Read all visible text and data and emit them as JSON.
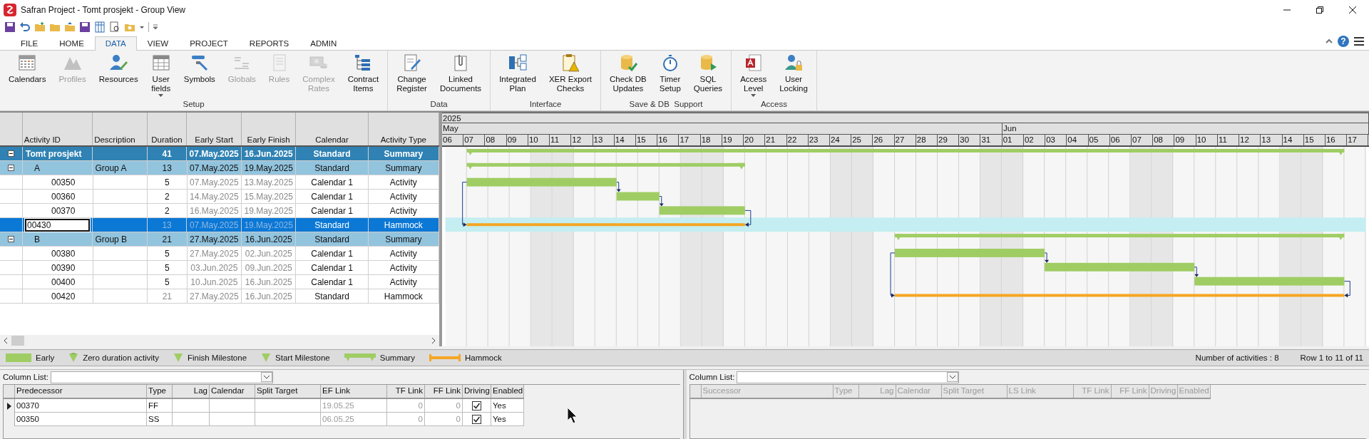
{
  "window": {
    "title": "Safran Project - Tomt prosjekt - Group View"
  },
  "tabs": [
    {
      "label": "FILE",
      "selected": false
    },
    {
      "label": "HOME",
      "selected": false
    },
    {
      "label": "DATA",
      "selected": true
    },
    {
      "label": "VIEW",
      "selected": false
    },
    {
      "label": "PROJECT",
      "selected": false
    },
    {
      "label": "REPORTS",
      "selected": false
    },
    {
      "label": "ADMIN",
      "selected": false
    }
  ],
  "help_button": "?",
  "ribbon": [
    {
      "label": "Setup",
      "buttons": [
        {
          "label": "Calendars",
          "disabled": false
        },
        {
          "label": "Profiles",
          "disabled": true
        },
        {
          "label": "Resources",
          "disabled": false
        },
        {
          "label": "User\nfields",
          "disabled": false,
          "dropdown": true
        },
        {
          "label": "Symbols",
          "disabled": false
        },
        {
          "label": "Globals",
          "disabled": true
        },
        {
          "label": "Rules",
          "disabled": true
        },
        {
          "label": "Complex\nRates",
          "disabled": true
        },
        {
          "label": "Contract\nItems",
          "disabled": false
        }
      ]
    },
    {
      "label": "Data",
      "buttons": [
        {
          "label": "Change\nRegister",
          "disabled": false
        },
        {
          "label": "Linked\nDocuments",
          "disabled": false
        }
      ]
    },
    {
      "label": "Interface",
      "buttons": [
        {
          "label": "Integrated\nPlan",
          "disabled": false
        },
        {
          "label": "XER Export\nChecks",
          "disabled": false
        }
      ]
    },
    {
      "label": "Save & DB  Support",
      "buttons": [
        {
          "label": "Check DB\nUpdates",
          "disabled": false
        },
        {
          "label": "Timer\nSetup",
          "disabled": false
        },
        {
          "label": "SQL\nQueries",
          "disabled": false
        }
      ]
    },
    {
      "label": "Access",
      "buttons": [
        {
          "label": "Access\nLevel",
          "disabled": false,
          "dropdown": true
        },
        {
          "label": "User\nLocking",
          "disabled": false
        }
      ]
    }
  ],
  "table": {
    "columns": [
      "Activity ID",
      "Description",
      "Duration",
      "Early Start",
      "Early Finish",
      "Calendar",
      "Activity Type"
    ],
    "rows": [
      {
        "kind": "project",
        "id": "Tomt prosjekt",
        "duration": "41",
        "early_start": "07.May.2025",
        "early_finish": "16.Jun.2025",
        "calendar": "Standard",
        "activity_type": "Summary",
        "expanded": true,
        "selected": false,
        "editing": false,
        "children": [
          {
            "kind": "group",
            "id": "A",
            "description": "Group A",
            "duration": "13",
            "early_start": "07.May.2025",
            "early_finish": "19.May.2025",
            "calendar": "Standard",
            "activity_type": "Summary",
            "expanded": true,
            "selected": false,
            "editing": false,
            "children": [
              {
                "kind": "activity",
                "id": "00350",
                "duration": "5",
                "early_start": "07.May.2025",
                "early_finish": "13.May.2025",
                "calendar": "Calendar 1",
                "activity_type": "Activity",
                "selected": false,
                "editing": false
              },
              {
                "kind": "activity",
                "id": "00360",
                "duration": "2",
                "early_start": "14.May.2025",
                "early_finish": "15.May.2025",
                "calendar": "Calendar 1",
                "activity_type": "Activity",
                "selected": false,
                "editing": false,
                "links": [
                  {
                    "kind": "finish_to_start"
                  }
                ]
              },
              {
                "kind": "activity",
                "id": "00370",
                "duration": "2",
                "early_start": "16.May.2025",
                "early_finish": "19.May.2025",
                "calendar": "Calendar 1",
                "activity_type": "Activity",
                "selected": false,
                "editing": false,
                "links": [
                  {
                    "kind": "finish_to_start"
                  }
                ]
              },
              {
                "kind": "hammock",
                "id": "00430",
                "duration": "13",
                "early_start": "07.May.2025",
                "early_finish": "19.May.2025",
                "calendar": "Standard",
                "activity_type": "Hammock",
                "selected": true,
                "editing": true,
                "links": [
                  {
                    "kind": "start_to_start"
                  },
                  {
                    "kind": "finish_to_finish"
                  }
                ]
              }
            ]
          },
          {
            "kind": "group",
            "id": "B",
            "description": "Group B",
            "duration": "21",
            "early_start": "27.May.2025",
            "early_finish": "16.Jun.2025",
            "calendar": "Standard",
            "activity_type": "Summary",
            "expanded": true,
            "selected": false,
            "editing": false,
            "children": [
              {
                "kind": "activity",
                "id": "00380",
                "duration": "5",
                "early_start": "27.May.2025",
                "early_finish": "02.Jun.2025",
                "calendar": "Calendar 1",
                "activity_type": "Activity",
                "selected": false,
                "editing": false
              },
              {
                "kind": "activity",
                "id": "00390",
                "duration": "5",
                "early_start": "03.Jun.2025",
                "early_finish": "09.Jun.2025",
                "calendar": "Calendar 1",
                "activity_type": "Activity",
                "selected": false,
                "editing": false,
                "links": [
                  {
                    "kind": "finish_to_start"
                  }
                ]
              },
              {
                "kind": "activity",
                "id": "00400",
                "duration": "5",
                "early_start": "10.Jun.2025",
                "early_finish": "16.Jun.2025",
                "calendar": "Calendar 1",
                "activity_type": "Activity",
                "selected": false,
                "editing": false,
                "links": [
                  {
                    "kind": "finish_to_start"
                  }
                ]
              },
              {
                "kind": "hammock",
                "id": "00420",
                "duration": "21",
                "early_start": "27.May.2025",
                "early_finish": "16.Jun.2025",
                "calendar": "Standard",
                "activity_type": "Hammock",
                "selected": false,
                "editing": false,
                "links": [
                  {
                    "kind": "start_to_start"
                  },
                  {
                    "kind": "finish_to_finish"
                  }
                ]
              }
            ]
          }
        ]
      }
    ]
  },
  "gantt": {
    "year": "2025",
    "months": [
      {
        "label": "May",
        "days": [
          "06",
          "07",
          "08",
          "09",
          "10",
          "11",
          "12",
          "13",
          "14",
          "15",
          "16",
          "17",
          "18",
          "19",
          "20",
          "21",
          "22",
          "23",
          "24",
          "25",
          "26",
          "27",
          "28",
          "29",
          "30",
          "31"
        ]
      },
      {
        "label": "Jun",
        "days": [
          "01",
          "02",
          "03",
          "04",
          "05",
          "06",
          "07",
          "08",
          "09",
          "10",
          "11",
          "12",
          "13",
          "14",
          "15",
          "16",
          "17"
        ]
      }
    ]
  },
  "legend": [
    {
      "kind": "early",
      "label": "Early"
    },
    {
      "kind": "zero_duration",
      "label": "Zero duration activity"
    },
    {
      "kind": "finish_milestone",
      "label": "Finish Milestone"
    },
    {
      "kind": "start_milestone",
      "label": "Start Milestone"
    },
    {
      "kind": "summary",
      "label": "Summary"
    },
    {
      "kind": "hammock",
      "label": "Hammock"
    }
  ],
  "status_bar": {
    "activity_count": "Number of activities : 8",
    "row_range": "Row 1 to 11 of 11"
  },
  "predecessors": {
    "column_list_label": "Column List:",
    "disabled": false,
    "columns": [
      "Predecessor",
      "Type",
      "Lag",
      "Calendar",
      "Split Target",
      "EF Link",
      "TF Link",
      "FF Link",
      "Driving",
      "Enabled"
    ],
    "rows": [
      {
        "current": true,
        "predecessor": "00370",
        "type": "FF",
        "ef_link": "19.05.25",
        "tf_link": "0",
        "ff_link": "0",
        "driving": true,
        "enabled": "Yes"
      },
      {
        "current": false,
        "predecessor": "00350",
        "type": "SS",
        "ef_link": "06.05.25",
        "tf_link": "0",
        "ff_link": "0",
        "driving": true,
        "enabled": "Yes"
      }
    ]
  },
  "successors": {
    "column_list_label": "Column List:",
    "disabled": true,
    "columns": [
      "Successor",
      "Type",
      "Lag",
      "Calendar",
      "Split Target",
      "LS Link",
      "TF Link",
      "FF Link",
      "Driving",
      "Enabled"
    ]
  }
}
